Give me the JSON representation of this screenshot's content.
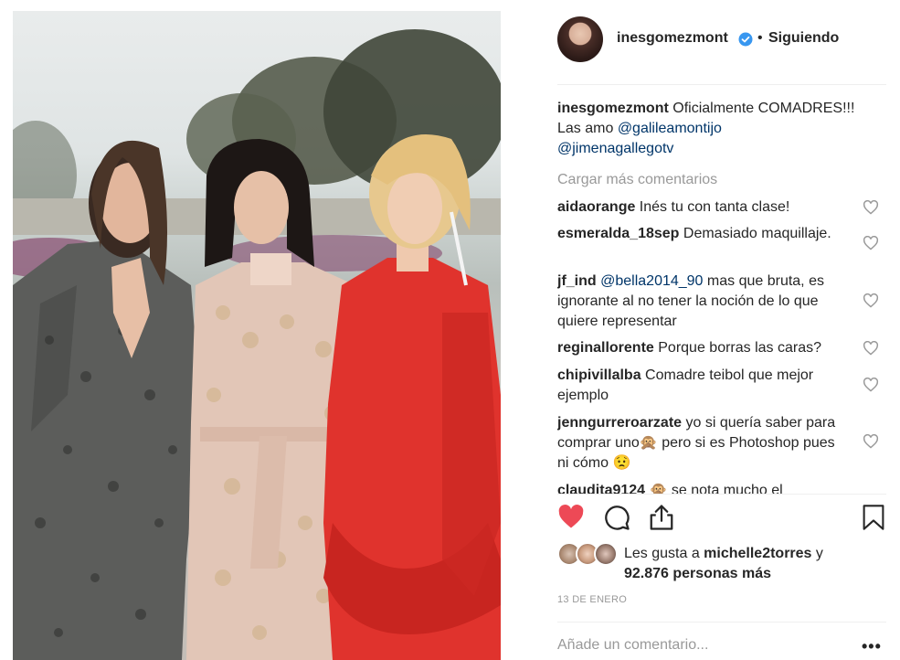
{
  "post": {
    "username": "inesgomezmont",
    "follow_separator": "•",
    "follow_status": "Siguiendo",
    "caption_user": "inesgomezmont",
    "caption_text": " Oficialmente COMADRES!!! Las amo ",
    "caption_mention1": "@galileamontijo",
    "caption_mention2": "@jimenagallegotv",
    "load_more": "Cargar más comentarios",
    "comments": [
      {
        "user": "aidaorange",
        "text": " Inés tu con tanta clase!"
      },
      {
        "user": "esmeralda_18sep",
        "text": " Demasiado maquillaje."
      },
      {
        "user": "jf_ind",
        "mention": " @bella2014_90",
        "text": " mas que bruta, es ignorante al no tener la noción de lo que quiere representar"
      },
      {
        "user": "reginallorente",
        "text": " Porque borras las caras?"
      },
      {
        "user": "chipivillalba",
        "text": " Comadre teibol que mejor ejemplo"
      },
      {
        "user": "jenngurreroarzate",
        "text": " yo si quería saber para comprar uno🙊 pero si es Photoshop pues ni cómo 😟"
      },
      {
        "user": "claudita9124",
        "text": " 🙊 se nota mucho el"
      }
    ],
    "likes_prefix": "Les gusta a ",
    "likes_user": "michelle2torres",
    "likes_suffix": " y",
    "likes_count": "92.876 personas más",
    "date": "13 DE ENERO",
    "add_comment_placeholder": "Añade un comentario...",
    "more_options": "•••",
    "liked": true
  },
  "icons": {
    "verified": "verified-badge-icon",
    "like": "heart-icon",
    "comment": "comment-icon",
    "share": "share-icon",
    "save": "bookmark-icon"
  },
  "colors": {
    "like_red": "#ed4956",
    "verified_blue": "#3897f0",
    "mention_blue": "#003569",
    "muted": "#999999"
  }
}
